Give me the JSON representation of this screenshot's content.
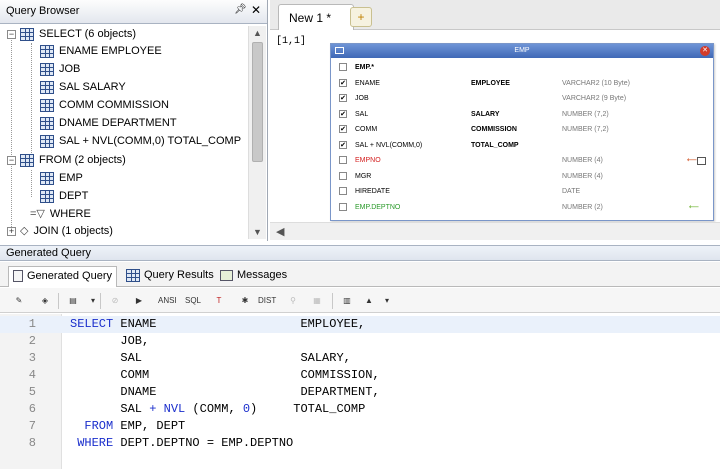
{
  "query_browser": {
    "title": "Query Browser",
    "pin_icon": "pin-icon",
    "close_label": "✕",
    "tree": [
      {
        "label": "SELECT   (6 objects)"
      },
      {
        "label": "ENAME EMPLOYEE"
      },
      {
        "label": "JOB"
      },
      {
        "label": "SAL SALARY"
      },
      {
        "label": "COMM COMMISSION"
      },
      {
        "label": "DNAME DEPARTMENT"
      },
      {
        "label": "SAL + NVL(COMM,0) TOTAL_COMP"
      },
      {
        "label": "FROM   (2 objects)"
      },
      {
        "label": "EMP"
      },
      {
        "label": "DEPT"
      },
      {
        "label": "WHERE"
      },
      {
        "label": "JOIN   (1 objects)"
      }
    ]
  },
  "editor": {
    "tab_label": "New 1 *",
    "add_tab_label": "+",
    "coord": "[1,1]",
    "emp_window": {
      "title": "EMP",
      "rows": [
        {
          "checked": false,
          "col": "EMP.*",
          "alias": "",
          "dtype": "",
          "bold": true
        },
        {
          "checked": true,
          "col": "ENAME",
          "alias": "EMPLOYEE",
          "dtype": "VARCHAR2 (10 Byte)"
        },
        {
          "checked": true,
          "col": "JOB",
          "alias": "",
          "dtype": "VARCHAR2 (9 Byte)"
        },
        {
          "checked": true,
          "col": "SAL",
          "alias": "SALARY",
          "dtype": "NUMBER (7,2)"
        },
        {
          "checked": true,
          "col": "COMM",
          "alias": "COMMISSION",
          "dtype": "NUMBER (7,2)"
        },
        {
          "checked": true,
          "col": "SAL + NVL(COMM,0)",
          "alias": "TOTAL_COMP",
          "dtype": ""
        },
        {
          "checked": false,
          "col": "EMPNO",
          "alias": "",
          "dtype": "NUMBER (4)",
          "color": "#d42020"
        },
        {
          "checked": false,
          "col": "MGR",
          "alias": "",
          "dtype": "NUMBER (4)"
        },
        {
          "checked": false,
          "col": "HIREDATE",
          "alias": "",
          "dtype": "DATE"
        },
        {
          "checked": false,
          "col": "EMP.DEPTNO",
          "alias": "",
          "dtype": "NUMBER (2)",
          "color": "#2a9a2a"
        }
      ]
    }
  },
  "generated_query": {
    "header": "Generated Query",
    "tabs": [
      {
        "label": "Generated Query"
      },
      {
        "label": "Query Results"
      },
      {
        "label": "Messages"
      }
    ],
    "toolbar": [
      "ANSI",
      "SQL",
      "T",
      "DIST"
    ],
    "lines": [
      {
        "n": "1",
        "tokens": [
          {
            "t": "SELECT ",
            "k": true
          },
          {
            "t": "ENAME                    EMPLOYEE,"
          }
        ]
      },
      {
        "n": "2",
        "tokens": [
          {
            "t": "       JOB,"
          }
        ]
      },
      {
        "n": "3",
        "tokens": [
          {
            "t": "       SAL                      SALARY,"
          }
        ]
      },
      {
        "n": "4",
        "tokens": [
          {
            "t": "       COMM                     COMMISSION,"
          }
        ]
      },
      {
        "n": "5",
        "tokens": [
          {
            "t": "       DNAME                    DEPARTMENT,"
          }
        ]
      },
      {
        "n": "6",
        "tokens": [
          {
            "t": "       SAL "
          },
          {
            "t": "+ NVL",
            "k": true
          },
          {
            "t": " (COMM, "
          },
          {
            "t": "0",
            "k": true
          },
          {
            "t": ")     TOTAL_COMP"
          }
        ]
      },
      {
        "n": "7",
        "tokens": [
          {
            "t": "  FROM ",
            "k": true
          },
          {
            "t": "EMP, DEPT"
          }
        ]
      },
      {
        "n": "8",
        "tokens": [
          {
            "t": " WHERE ",
            "k": true
          },
          {
            "t": "DEPT.DEPTNO = EMP.DEPTNO"
          }
        ]
      }
    ]
  }
}
